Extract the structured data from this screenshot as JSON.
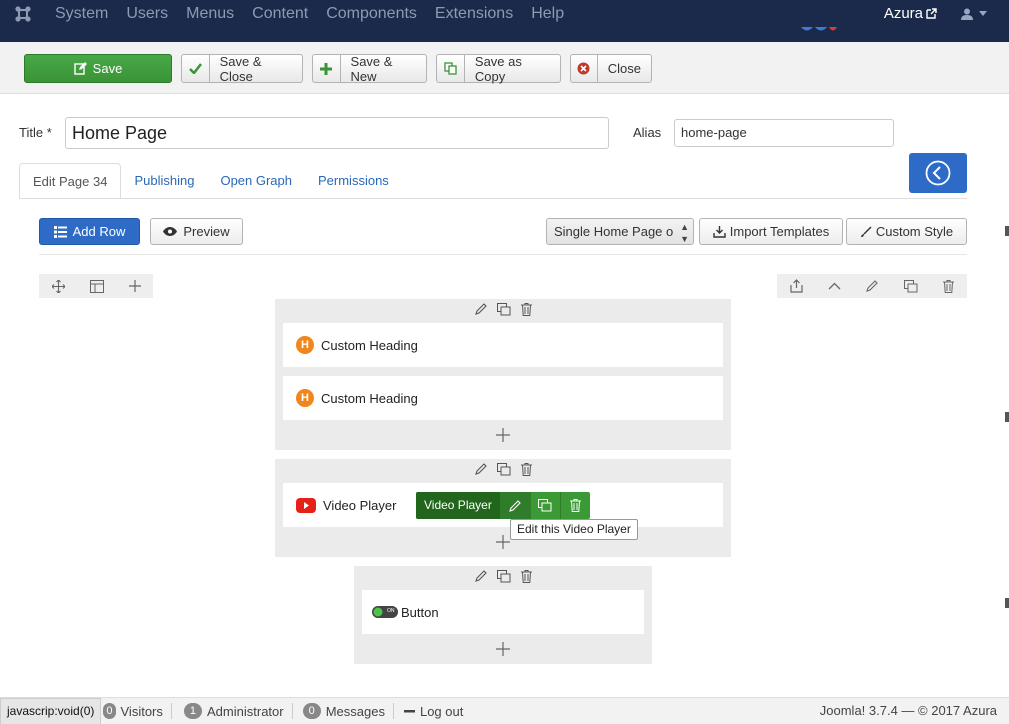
{
  "topnav": {
    "menu": [
      "System",
      "Users",
      "Menus",
      "Content",
      "Components",
      "Extensions",
      "Help"
    ],
    "site_name": "Azura"
  },
  "toolbar": {
    "save": "Save",
    "save_close": "Save & Close",
    "save_new": "Save & New",
    "save_copy": "Save as Copy",
    "close": "Close"
  },
  "form": {
    "title_label": "Title *",
    "title_value": "Home Page",
    "alias_label": "Alias",
    "alias_value": "home-page"
  },
  "tabs": [
    "Edit Page 34",
    "Publishing",
    "Open Graph",
    "Permissions"
  ],
  "builder": {
    "add_row": "Add Row",
    "preview": "Preview",
    "template_select": "Single Home Page o",
    "import_templates": "Import Templates",
    "custom_style": "Custom Style"
  },
  "addons": {
    "heading1": "Custom Heading",
    "heading2": "Custom Heading",
    "video": "Video Player",
    "button": "Button",
    "video_toolbar_label": "Video Player",
    "tooltip": "Edit this Video Player",
    "heading_badge": "H",
    "toggle_on": "ON"
  },
  "footer": {
    "status_url": "javascrip:void(0)",
    "visitors_count": "0",
    "visitors": "Visitors",
    "admin_count": "1",
    "admin": "Administrator",
    "messages_count": "0",
    "messages": "Messages",
    "logout": "Log out",
    "version": "Joomla! 3.7.4  —  © 2017 Azura"
  },
  "colors": {
    "nav_bg": "#1b2a4a",
    "save_green": "#3a9437",
    "primary_blue": "#2d6bc7",
    "heading_orange": "#f0861e",
    "youtube_red": "#e62117"
  }
}
